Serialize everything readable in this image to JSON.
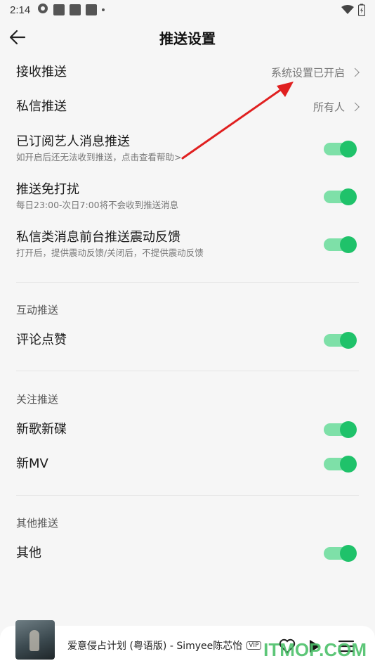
{
  "status_bar": {
    "time": "2:14"
  },
  "header": {
    "title": "推送设置"
  },
  "rows": {
    "receive": {
      "title": "接收推送",
      "value": "系统设置已开启"
    },
    "private": {
      "title": "私信推送",
      "value": "所有人"
    },
    "artist": {
      "title": "已订阅艺人消息推送",
      "sub": "如开启后还无法收到推送，点击查看帮助>",
      "on": true
    },
    "dnd": {
      "title": "推送免打扰",
      "sub": "每日23:00-次日7:00将不会收到推送消息",
      "on": true
    },
    "vibrate": {
      "title": "私信类消息前台推送震动反馈",
      "sub": "打开后，提供震动反馈/关闭后，不提供震动反馈",
      "on": true
    }
  },
  "sections": {
    "interact": {
      "label": "互动推送",
      "items": [
        {
          "title": "评论点赞",
          "on": true
        }
      ]
    },
    "follow": {
      "label": "关注推送",
      "items": [
        {
          "title": "新歌新碟",
          "on": true
        },
        {
          "title": "新MV",
          "on": true
        }
      ]
    },
    "other": {
      "label": "其他推送",
      "items": [
        {
          "title": "其他",
          "on": true
        }
      ]
    }
  },
  "player": {
    "track": "爱意侵占计划 (粤语版) - Simyee陈芯怡",
    "badge": "VIP"
  },
  "watermark": "ITMOP.COM",
  "colors": {
    "toggle_on": "#1fc26a",
    "toggle_track": "#7ee0a8",
    "annotation_arrow": "#e02020"
  }
}
